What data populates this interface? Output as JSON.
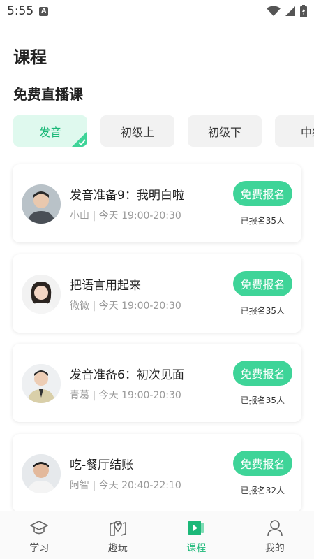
{
  "status_bar": {
    "time": "5:55",
    "app_icon": "A"
  },
  "page_title": "课程",
  "section_title": "免费直播课",
  "tabs": [
    {
      "label": "发音",
      "active": true
    },
    {
      "label": "初级上",
      "active": false
    },
    {
      "label": "初级下",
      "active": false
    },
    {
      "label": "中级",
      "active": false
    }
  ],
  "courses": [
    {
      "title": "发音准备9：我明白啦",
      "teacher": "小山",
      "time": "今天 19:00-20:30",
      "button": "免费报名",
      "count": "已报名35人"
    },
    {
      "title": "把语言用起来",
      "teacher": "微微",
      "time": "今天 19:00-20:30",
      "button": "免费报名",
      "count": "已报名35人"
    },
    {
      "title": "发音准备6：初次见面",
      "teacher": "青葛",
      "time": "今天 19:00-20:30",
      "button": "免费报名",
      "count": "已报名35人"
    },
    {
      "title": "吃-餐厅结账",
      "teacher": "阿智",
      "time": "今天 20:40-22:10",
      "button": "免费报名",
      "count": "已报名32人"
    }
  ],
  "nav": [
    {
      "label": "学习",
      "icon": "graduation-cap-icon",
      "active": false
    },
    {
      "label": "趣玩",
      "icon": "map-pin-icon",
      "active": false
    },
    {
      "label": "课程",
      "icon": "video-play-icon",
      "active": true
    },
    {
      "label": "我的",
      "icon": "person-icon",
      "active": false
    }
  ],
  "colors": {
    "accent": "#3ed498",
    "accent_text": "#1bb878",
    "tab_active_bg": "#dff9ee"
  }
}
